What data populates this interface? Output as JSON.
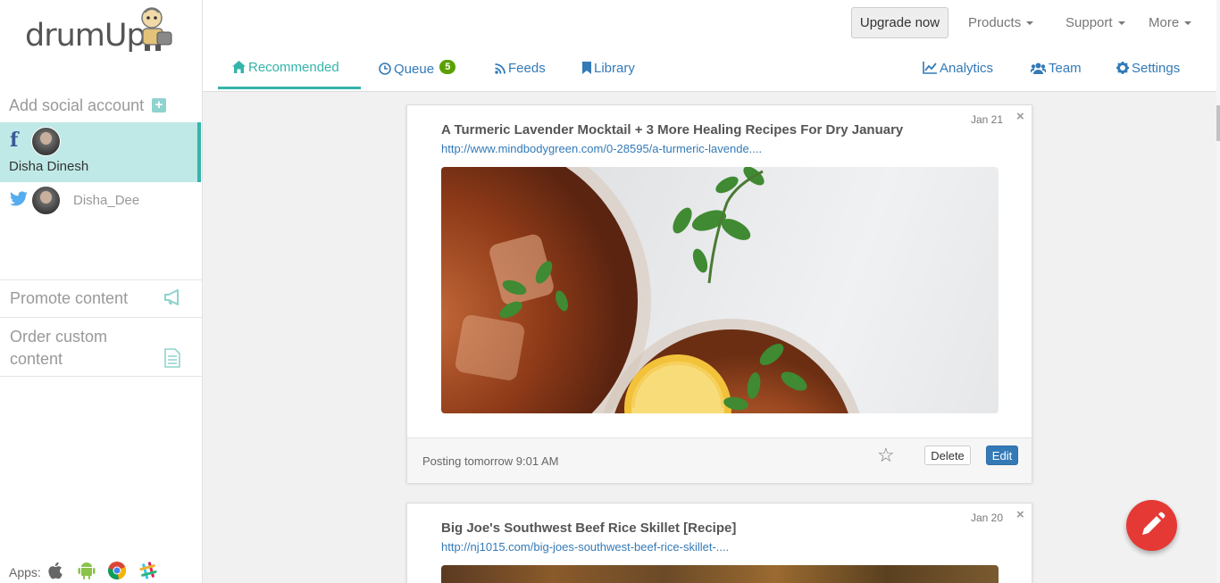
{
  "logo": {
    "text": "drumUp"
  },
  "sidebar": {
    "add_account": "Add social account",
    "accounts": [
      {
        "network": "facebook",
        "name": "Disha Dinesh",
        "active": true
      },
      {
        "network": "twitter",
        "name": "Disha_Dee",
        "active": false
      }
    ],
    "promote": "Promote content",
    "order": "Order custom content",
    "apps_label": "Apps:",
    "apps": [
      "apple-icon",
      "android-icon",
      "chrome-icon",
      "slack-icon"
    ]
  },
  "topbar": {
    "upgrade": "Upgrade now",
    "menus": [
      "Products",
      "Support",
      "More"
    ]
  },
  "nav": {
    "tabs": [
      {
        "label": "Recommended",
        "icon": "home-icon",
        "active": true
      },
      {
        "label": "Queue",
        "icon": "clock-icon",
        "badge": "5"
      },
      {
        "label": "Feeds",
        "icon": "rss-icon"
      },
      {
        "label": "Library",
        "icon": "bookmark-icon"
      }
    ],
    "right": [
      {
        "label": "Analytics",
        "icon": "line-chart-icon"
      },
      {
        "label": "Team",
        "icon": "users-icon"
      },
      {
        "label": "Settings",
        "icon": "gear-icon"
      }
    ]
  },
  "cards": [
    {
      "title": "A Turmeric Lavender Mocktail + 3 More Healing Recipes For Dry January",
      "link": "http://www.mindbodygreen.com/0-28595/a-turmeric-lavende....",
      "date": "Jan 21",
      "posting": "Posting tomorrow 9:01 AM",
      "delete": "Delete",
      "edit": "Edit"
    },
    {
      "title": "Big Joe's Southwest Beef Rice Skillet [Recipe]",
      "link": "http://nj1015.com/big-joes-southwest-beef-rice-skillet-....",
      "date": "Jan 20"
    }
  ],
  "colors": {
    "accent": "#35b4ab",
    "link": "#337ab7",
    "fab": "#e53935",
    "badge": "#5ba000"
  }
}
